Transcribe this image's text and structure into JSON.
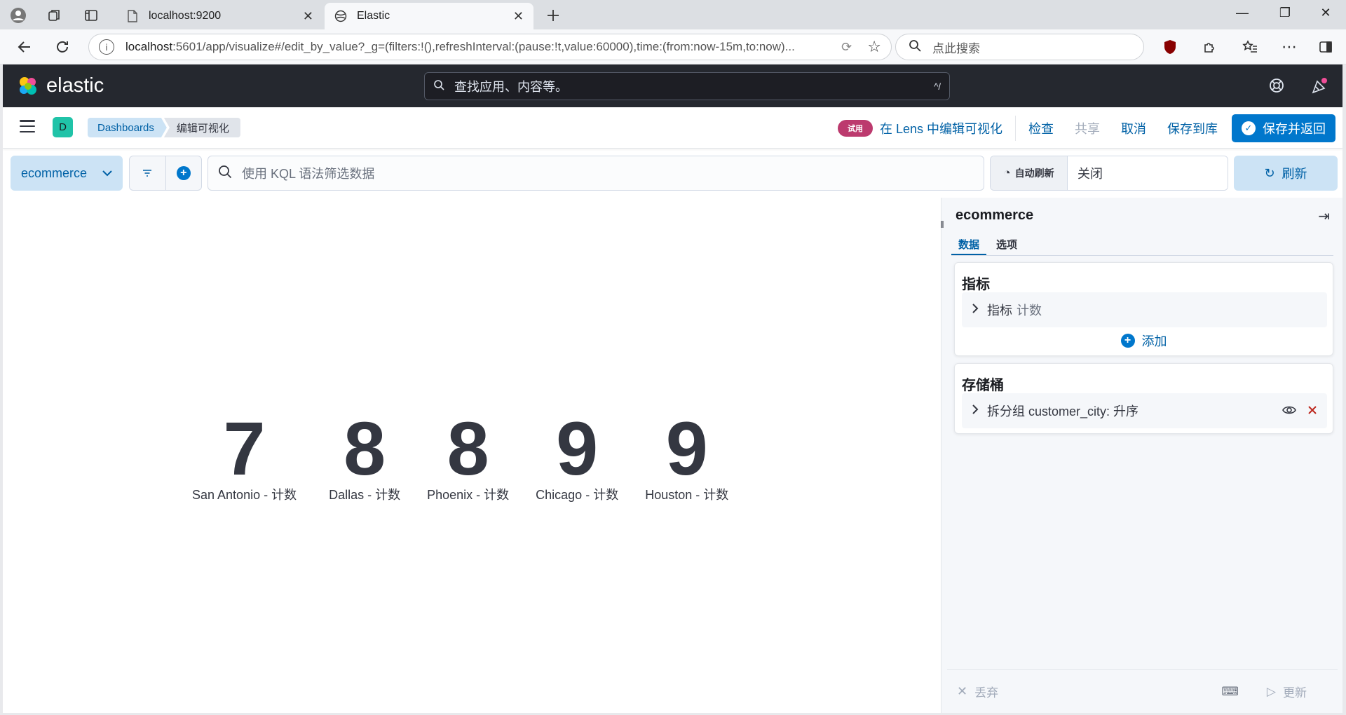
{
  "browser": {
    "tabs": [
      {
        "title": "localhost:9200",
        "favicon": "page-icon"
      },
      {
        "title": "Elastic",
        "favicon": "elastic-icon"
      }
    ],
    "url": {
      "host": "localhost",
      "path": ":5601/app/visualize#/edit_by_value?_g=(filters:!(),refreshInterval:(pause:!t,value:60000),time:(from:now-15m,to:now)..."
    },
    "search_placeholder": "点此搜索"
  },
  "header": {
    "logo_text": "elastic",
    "global_search_placeholder": "查找应用、内容等。",
    "global_search_shortcut": "^/"
  },
  "subheader": {
    "space_initial": "D",
    "breadcrumbs": [
      "Dashboards",
      "编辑可视化"
    ],
    "trial_badge": "试用",
    "lens_link": "在 Lens 中编辑可视化",
    "actions": {
      "inspect": "检查",
      "share": "共享",
      "cancel": "取消",
      "save_library": "保存到库",
      "save_return": "保存并返回"
    }
  },
  "query_bar": {
    "data_view": "ecommerce",
    "kql_placeholder": "使用 KQL 语法筛选数据",
    "auto_refresh_label": "自动刷新",
    "auto_refresh_value": "关闭",
    "refresh_label": "刷新"
  },
  "metrics": [
    {
      "value": "7",
      "label": "San Antonio - 计数"
    },
    {
      "value": "8",
      "label": "Dallas - 计数"
    },
    {
      "value": "8",
      "label": "Phoenix - 计数"
    },
    {
      "value": "9",
      "label": "Chicago - 计数"
    },
    {
      "value": "9",
      "label": "Houston - 计数"
    }
  ],
  "sidebar": {
    "title": "ecommerce",
    "tabs": [
      "数据",
      "选项"
    ],
    "metrics_section": {
      "title": "指标",
      "row_label": "指标",
      "row_value": "计数",
      "add_label": "添加"
    },
    "buckets_section": {
      "title": "存储桶",
      "row_label": "拆分组 customer_city: 升序"
    },
    "footer": {
      "discard": "丢弃",
      "update": "更新"
    }
  },
  "colors": {
    "accent": "#0077cc",
    "header_bg": "#25282f",
    "trial": "#bc3a6e",
    "space_avatar": "#20c3a8"
  }
}
